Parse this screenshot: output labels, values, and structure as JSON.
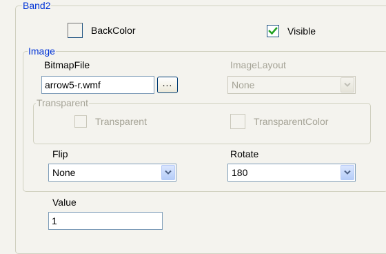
{
  "band": {
    "legend": "Band2",
    "backcolor": {
      "label": "BackColor",
      "checked": false
    },
    "visible": {
      "label": "Visible",
      "checked": true
    }
  },
  "image": {
    "legend": "Image",
    "bitmap_file": {
      "label": "BitmapFile",
      "value": "arrow5-r.wmf",
      "browse_label": "..."
    },
    "image_layout": {
      "label": "ImageLayout",
      "value": "None",
      "enabled": false
    },
    "transparent_group": {
      "legend": "Transparent",
      "transparent": {
        "label": "Transparent",
        "checked": false,
        "enabled": false
      },
      "transparent_color": {
        "label": "TransparentColor",
        "enabled": false
      }
    },
    "flip": {
      "label": "Flip",
      "value": "None"
    },
    "rotate": {
      "label": "Rotate",
      "value": "180"
    }
  },
  "value_field": {
    "label": "Value",
    "value": "1"
  },
  "colors": {
    "legend_blue": "#0033d6",
    "disabled_text": "#a5a396",
    "panel_bg": "#f4f3ee",
    "checkmark_green": "#21a121"
  }
}
